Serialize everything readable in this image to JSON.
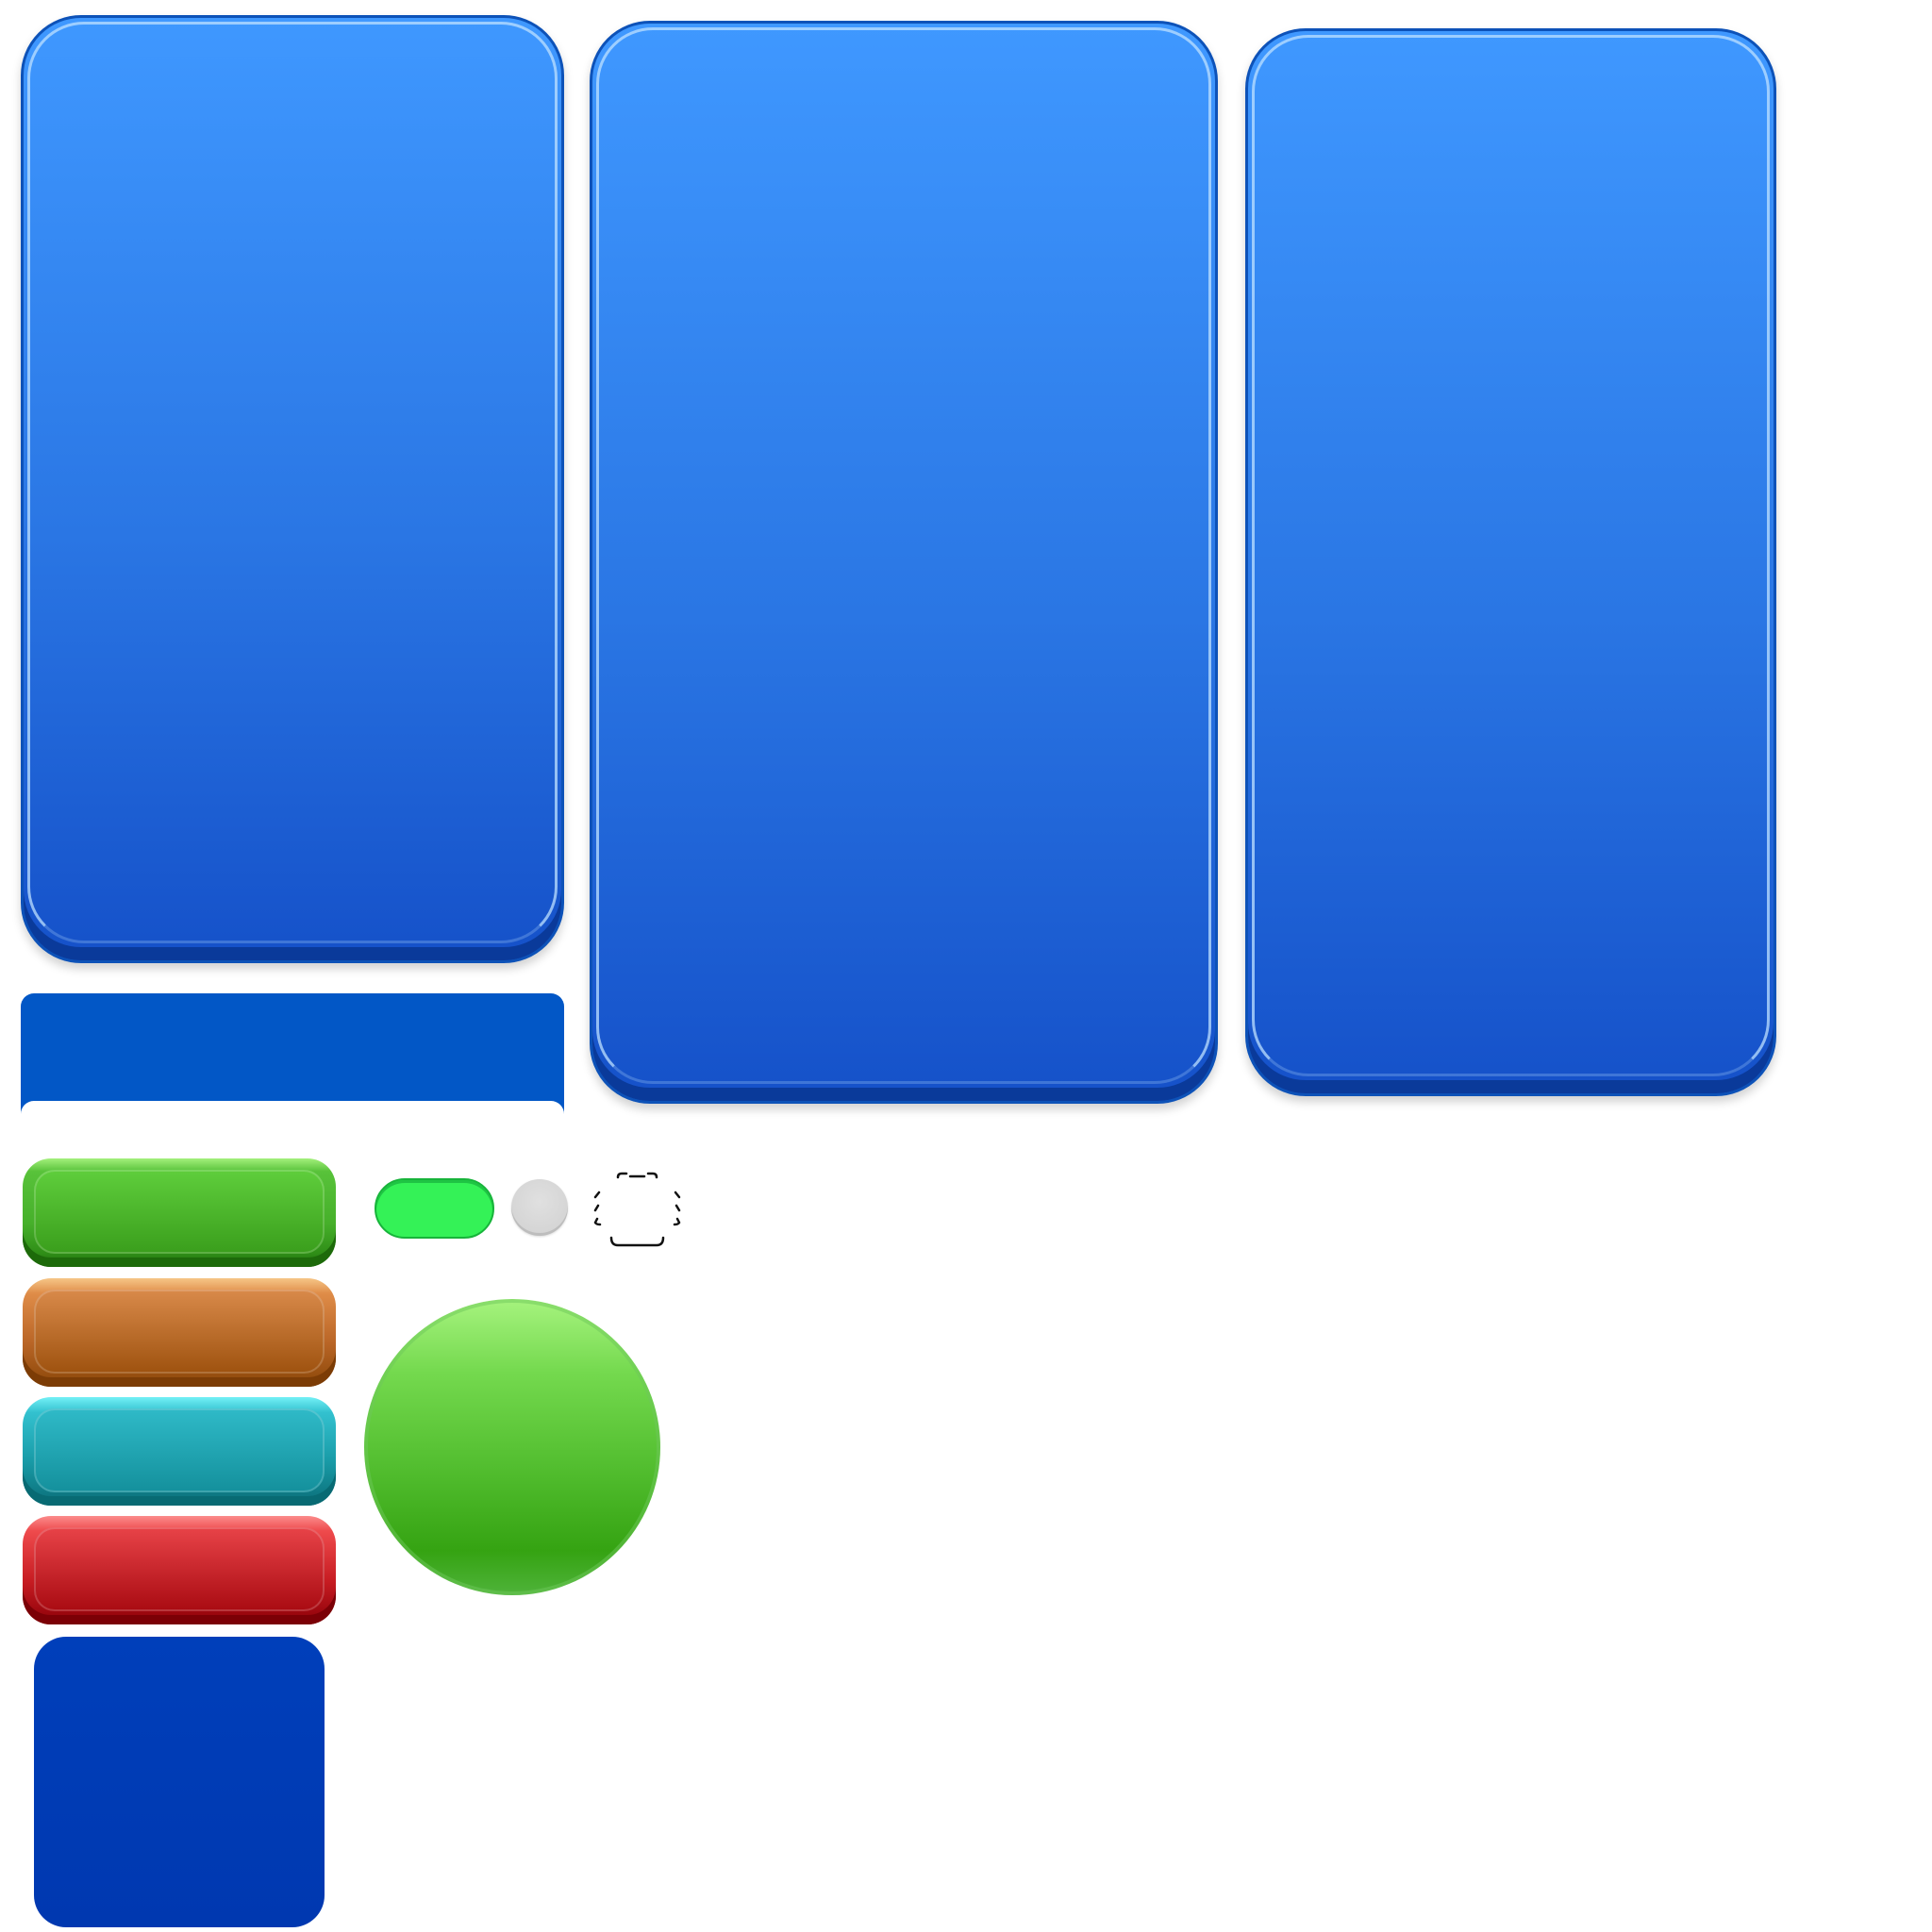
{
  "sheet": {
    "kind": "game UI sprite sheet",
    "background": "transparent"
  },
  "colors": {
    "panel_top": "#3f98ff",
    "panel_bottom": "#1551c9",
    "panel_border": "#0d52b8",
    "header_strip": "#0257c6",
    "btn_green": "#46b02a",
    "btn_orange": "#b96526",
    "btn_teal": "#189aa6",
    "btn_red": "#c71c22",
    "square_blue": "#003fba",
    "toggle_on": "#34f257",
    "toggle_knob": "#d9d9d9",
    "round_green": "#4fbb2c"
  },
  "sprites": [
    "panel-large-1",
    "panel-large-2",
    "panel-large-3",
    "header-strip",
    "button-green",
    "button-orange",
    "button-teal",
    "button-red",
    "square-dark-blue",
    "toggle-pill-on",
    "toggle-knob",
    "selection-frame-icon",
    "round-button-green"
  ]
}
